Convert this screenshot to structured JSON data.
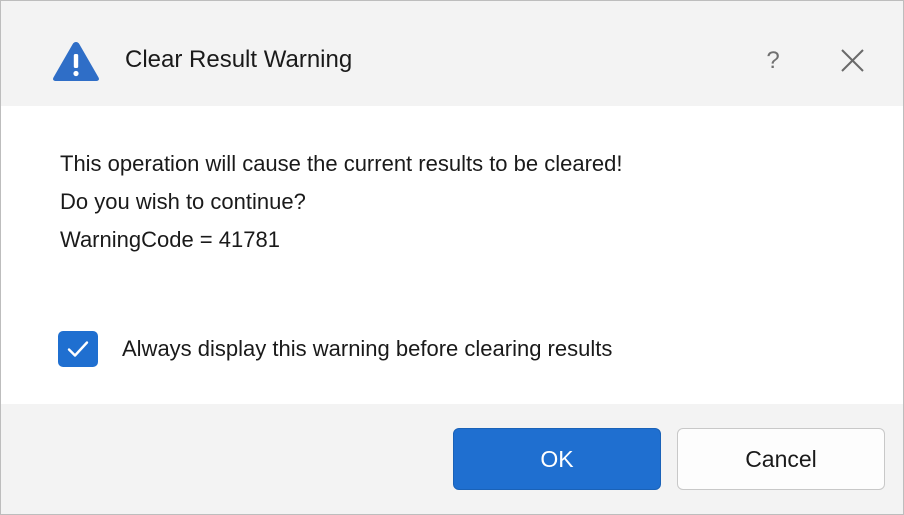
{
  "dialog": {
    "title": "Clear Result Warning",
    "title_icon": "warning-triangle-icon",
    "help_label": "?",
    "close_icon": "close-icon",
    "message_lines": [
      "This operation will cause the current results to be cleared!",
      "Do you wish to continue?",
      "WarningCode = 41781"
    ],
    "checkbox": {
      "label": "Always display this warning before clearing results",
      "checked": true
    },
    "buttons": {
      "ok_label": "OK",
      "cancel_label": "Cancel"
    }
  },
  "colors": {
    "accent": "#1f6fd0",
    "warning_icon": "#2f6ec7",
    "titlebar_bg": "#f3f3f3"
  }
}
